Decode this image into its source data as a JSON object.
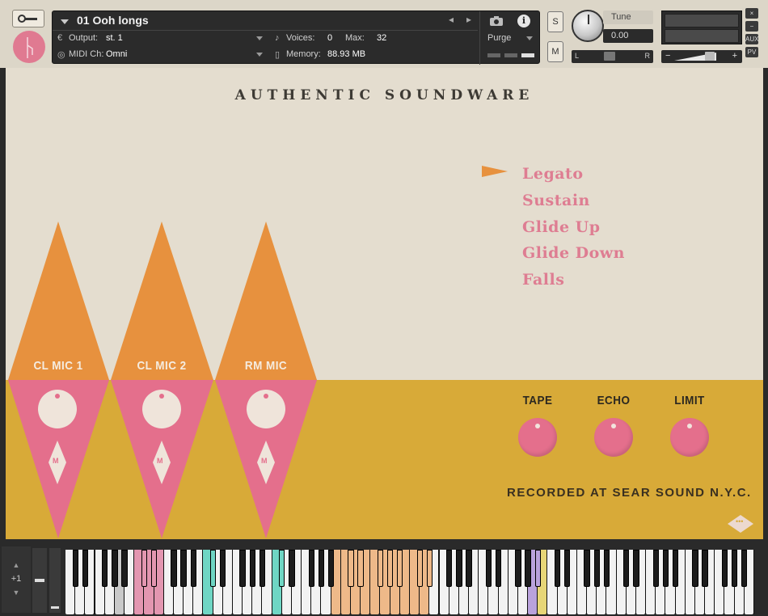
{
  "header": {
    "instrument_name": "01 Ooh longs",
    "output_label": "Output:",
    "output_value": "st. 1",
    "voices_label": "Voices:",
    "voices_value": "0",
    "max_label": "Max:",
    "max_value": "32",
    "purge_label": "Purge",
    "midi_label": "MIDI Ch:",
    "midi_value": "Omni",
    "memory_label": "Memory:",
    "memory_value": "88.93 MB",
    "solo_label": "S",
    "mute_label": "M",
    "tune_label": "Tune",
    "tune_value": "0.00",
    "pan_left": "L",
    "pan_right": "R",
    "vol_minus": "−",
    "vol_plus": "+",
    "side_buttons": [
      "×",
      "−",
      "AUX",
      "PV"
    ],
    "info_symbol": "i",
    "nav_prev": "◂",
    "nav_next": "▸"
  },
  "instrument": {
    "brand": "AUTHENTIC SOUNDWARE",
    "articulations": [
      "Legato",
      "Sustain",
      "Glide Up",
      "Glide Down",
      "Falls"
    ],
    "selected_articulation": "Legato",
    "mics": [
      {
        "label": "CL MIC 1",
        "mute": "M"
      },
      {
        "label": "CL MIC 2",
        "mute": "M"
      },
      {
        "label": "RM MIC",
        "mute": "M"
      }
    ],
    "fx": [
      {
        "label": "TAPE"
      },
      {
        "label": "ECHO"
      },
      {
        "label": "LIMIT"
      }
    ],
    "footer_text": "RECORDED AT SEAR SOUND N.Y.C.",
    "more_label": "•••"
  },
  "keyboard": {
    "octave_label": "+1",
    "colors": {
      "white": "#f2f2f2",
      "black": "#1c1c1c",
      "pink": "#e396b0",
      "teal": "#6fd6c4",
      "tan": "#eeb989",
      "lavender": "#b9a2dc",
      "yellow": "#e7d677",
      "pressed": "#c9c9c9"
    }
  },
  "colors": {
    "orange": "#e7913e",
    "pink": "#e46f8c",
    "mustard": "#d8aa38",
    "cream": "#e4ddcf"
  }
}
